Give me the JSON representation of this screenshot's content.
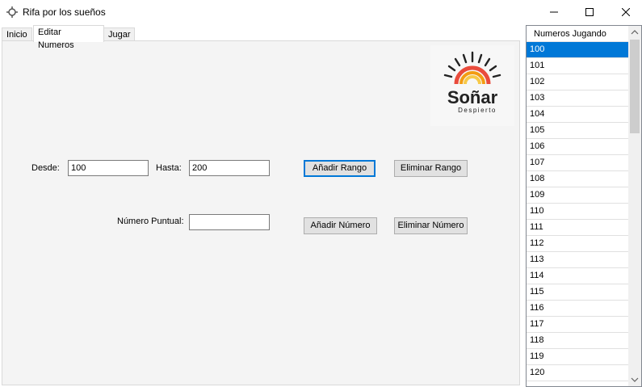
{
  "window": {
    "title": "Rifa por los sueños"
  },
  "tabs": [
    "Inicio",
    "Editar Numeros",
    "Jugar"
  ],
  "active_tab": "Editar Numeros",
  "form": {
    "desde_label": "Desde:",
    "desde_value": "100",
    "hasta_label": "Hasta:",
    "hasta_value": "200",
    "add_range_label": "Añadir Rango",
    "remove_range_label": "Eliminar Rango",
    "puntual_label": "Número Puntual:",
    "puntual_value": "",
    "add_number_label": "Añadir Número",
    "remove_number_label": "Eliminar Número"
  },
  "logo": {
    "brand": "Soñar",
    "tagline": "Despierto"
  },
  "list": {
    "header": "Numeros Jugando",
    "selected": "100",
    "items": [
      "100",
      "101",
      "102",
      "103",
      "104",
      "105",
      "106",
      "107",
      "108",
      "109",
      "110",
      "111",
      "112",
      "113",
      "114",
      "115",
      "116",
      "117",
      "118",
      "119",
      "120"
    ]
  },
  "colors": {
    "accent": "#0078d7",
    "logo_red": "#e94b3c",
    "logo_orange": "#f39c12",
    "logo_yellow": "#f7c948"
  }
}
